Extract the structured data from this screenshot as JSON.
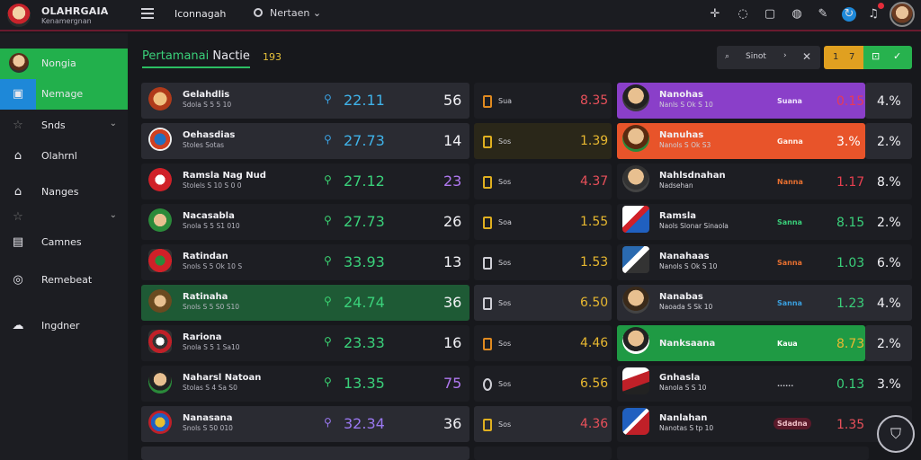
{
  "app": {
    "title": "OLAHRGAIA",
    "subtitle": "Kenamergnan"
  },
  "topbar": {
    "crumb": "Iconnagah",
    "picker": "Nertaen",
    "icons": [
      "plus-icon",
      "chat-icon",
      "square-icon",
      "globe-icon",
      "pen-icon",
      "sync-icon",
      "bell-icon"
    ]
  },
  "sidebar": {
    "items": [
      {
        "label": "Nongia",
        "icon": "avatar-icon"
      },
      {
        "label": "Nemage",
        "icon": "image-icon"
      },
      {
        "label": "Snds",
        "icon": "star-icon"
      },
      {
        "label": "Olahrnl",
        "icon": "home-icon"
      },
      {
        "label": "Nanges",
        "icon": "building-icon"
      },
      {
        "label": "",
        "icon": "star-icon"
      },
      {
        "label": "Camnes",
        "icon": "calendar-icon"
      },
      {
        "label": "Remebeat",
        "icon": "target-icon"
      },
      {
        "label": "Ingdner",
        "icon": "cloud-icon"
      }
    ]
  },
  "main": {
    "title_a": "Pertamanai",
    "title_b": "Nactie",
    "count": "193",
    "filter": {
      "a": "⌕",
      "b": "Sinot",
      "c": "›",
      "d": "✕"
    },
    "btn_yellow": {
      "a": "1",
      "b": "7"
    },
    "btn_green": {
      "a": "⊡",
      "b": "✓"
    }
  },
  "rows": [
    {
      "name": "Gelahdlis",
      "sub": "Sdola S 5 5 10",
      "val": "22.11",
      "num": "56",
      "mid": "Sua",
      "odds": "8.35",
      "player": "Nanohas",
      "psub": "Nanls S Ok S 10",
      "tag": "Suana",
      "rv": "0.15",
      "rp": "4.%"
    },
    {
      "name": "Oehasdias",
      "sub": "Stoles Sotas",
      "val": "27.73",
      "num": "14",
      "mid": "Sos",
      "odds": "1.39",
      "player": "Nanuhas",
      "psub": "Nanols S Ok S3",
      "tag": "Ganna",
      "rv": "3.%",
      "rp": "2.%"
    },
    {
      "name": "Ramsla Nag Nud",
      "sub": "Stolels S 10 S 0 0",
      "val": "27.12",
      "num": "23",
      "mid": "Sos",
      "odds": "4.37",
      "player": "Nahlsdnahan",
      "psub": "Nadsehan",
      "tag": "Nanna",
      "rv": "1.17",
      "rp": "8.%"
    },
    {
      "name": "Nacasabla",
      "sub": "Snola S 5 S1 010",
      "val": "27.73",
      "num": "26",
      "mid": "Soa",
      "odds": "1.55",
      "player": "Ramsla",
      "psub": "Naols Slonar Sinaola",
      "tag": "Sanna",
      "rv": "8.15",
      "rp": "2.%"
    },
    {
      "name": "Ratindan",
      "sub": "Snols S 5 Ok 10 S",
      "val": "33.93",
      "num": "13",
      "mid": "Sos",
      "odds": "1.53",
      "player": "Nanahaas",
      "psub": "Nanols S Ok S 10",
      "tag": "Sanna",
      "rv": "1.03",
      "rp": "6.%"
    },
    {
      "name": "Ratinaha",
      "sub": "Snols S 5 S0 S10",
      "val": "24.74",
      "num": "36",
      "mid": "Sos",
      "odds": "6.50",
      "player": "Nanabas",
      "psub": "Naoada S Sk 10",
      "tag": "Sanna",
      "rv": "1.23",
      "rp": "4.%"
    },
    {
      "name": "Rariona",
      "sub": "Snola S 5 1 Sa10",
      "val": "23.33",
      "num": "16",
      "mid": "Sos",
      "odds": "4.46",
      "player": "Nanksaana",
      "psub": "",
      "tag": "Kaua",
      "rv": "8.73",
      "rp": "2.%"
    },
    {
      "name": "Naharsl Natoan",
      "sub": "Stolas S 4 Sa S0",
      "val": "13.35",
      "num": "75",
      "mid": "Sos",
      "odds": "6.56",
      "player": "Gnhasla",
      "psub": "Nanola S S 10",
      "tag": "......",
      "rv": "0.13",
      "rp": "3.%"
    },
    {
      "name": "Nanasana",
      "sub": "Snols S 50 010",
      "val": "32.34",
      "num": "36",
      "mid": "Sos",
      "odds": "4.36",
      "player": "Nanlahan",
      "psub": "Nanotas S tp 10",
      "tag": "Sdadna",
      "rv": "1.35",
      "rp": ""
    }
  ],
  "colors": {
    "accent_green": "#22b04c",
    "accent_blue": "#1e88d8",
    "highlight_purple": "#8a3fc9",
    "highlight_orange": "#e8542a"
  }
}
